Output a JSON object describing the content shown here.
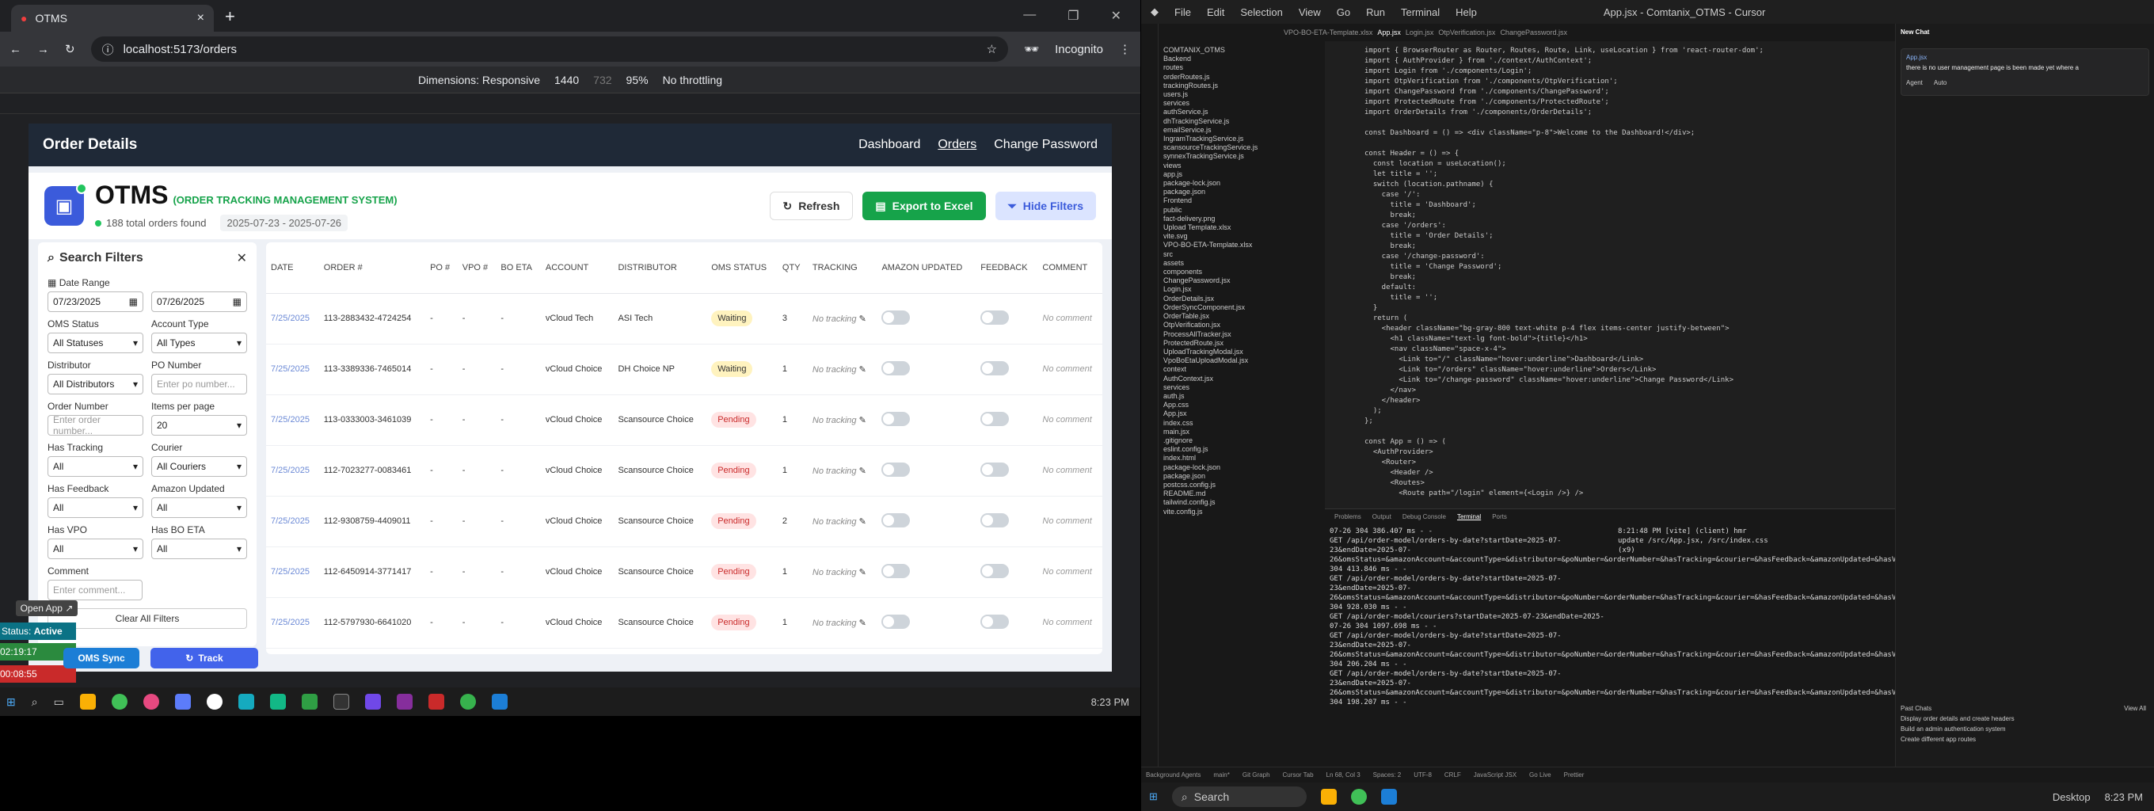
{
  "browser": {
    "tab_title": "OTMS",
    "url": "localhost:5173/orders",
    "profile": "Incognito",
    "dimensions_label": "Dimensions: Responsive",
    "width_value": "1440",
    "height_value": "732",
    "zoom": "95%",
    "throttling": "No throttling"
  },
  "app": {
    "page_title": "Order Details",
    "nav": [
      "Dashboard",
      "Orders",
      "Change Password"
    ],
    "brand": "OTMS",
    "brand_sub": "(ORDER TRACKING MANAGEMENT SYSTEM)",
    "orders_found": "188 total orders found",
    "date_range": "2025-07-23 - 2025-07-26",
    "refresh_label": "Refresh",
    "export_label": "Export to Excel",
    "hide_filters_label": "Hide Filters"
  },
  "filters": {
    "title": "Search Filters",
    "date_range_label": "Date Range",
    "date_from": "07/23/2025",
    "date_to": "07/26/2025",
    "oms_status_label": "OMS Status",
    "oms_status_value": "All Statuses",
    "account_type_label": "Account Type",
    "account_type_value": "All Types",
    "distributor_label": "Distributor",
    "distributor_value": "All Distributors",
    "po_number_label": "PO Number",
    "po_number_placeholder": "Enter po number...",
    "order_number_label": "Order Number",
    "order_number_placeholder": "Enter order number...",
    "items_per_page_label": "Items per page",
    "items_per_page_value": "20",
    "has_tracking_label": "Has Tracking",
    "has_tracking_value": "All",
    "courier_label": "Courier",
    "courier_value": "All Couriers",
    "has_feedback_label": "Has Feedback",
    "has_feedback_value": "All",
    "amazon_updated_label": "Amazon Updated",
    "amazon_updated_value": "All",
    "has_vpo_label": "Has VPO",
    "has_vpo_value": "All",
    "has_bo_eta_label": "Has BO ETA",
    "has_bo_eta_value": "All",
    "comment_label": "Comment",
    "comment_placeholder": "Enter comment...",
    "clear_all_label": "Clear All Filters"
  },
  "table": {
    "headers": [
      "DATE",
      "ORDER #",
      "PO #",
      "VPO #",
      "BO ETA",
      "ACCOUNT",
      "DISTRIBUTOR",
      "OMS STATUS",
      "QTY",
      "TRACKING",
      "AMAZON UPDATED",
      "FEEDBACK",
      "COMMENT"
    ],
    "rows": [
      {
        "date": "7/25/2025",
        "order": "113-2883432-4724254",
        "po": "-",
        "vpo": "-",
        "bo_eta": "-",
        "account": "vCloud Tech",
        "distributor": "ASI Tech",
        "status": "Waiting",
        "qty": "3",
        "tracking": "No tracking",
        "comment": "No comment"
      },
      {
        "date": "7/25/2025",
        "order": "113-3389336-7465014",
        "po": "-",
        "vpo": "-",
        "bo_eta": "-",
        "account": "vCloud Choice",
        "distributor": "DH Choice NP",
        "status": "Waiting",
        "qty": "1",
        "tracking": "No tracking",
        "comment": "No comment"
      },
      {
        "date": "7/25/2025",
        "order": "113-0333003-3461039",
        "po": "-",
        "vpo": "-",
        "bo_eta": "-",
        "account": "vCloud Choice",
        "distributor": "Scansource Choice",
        "status": "Pending",
        "qty": "1",
        "tracking": "No tracking",
        "comment": "No comment"
      },
      {
        "date": "7/25/2025",
        "order": "112-7023277-0083461",
        "po": "-",
        "vpo": "-",
        "bo_eta": "-",
        "account": "vCloud Choice",
        "distributor": "Scansource Choice",
        "status": "Pending",
        "qty": "1",
        "tracking": "No tracking",
        "comment": "No comment"
      },
      {
        "date": "7/25/2025",
        "order": "112-9308759-4409011",
        "po": "-",
        "vpo": "-",
        "bo_eta": "-",
        "account": "vCloud Choice",
        "distributor": "Scansource Choice",
        "status": "Pending",
        "qty": "2",
        "tracking": "No tracking",
        "comment": "No comment"
      },
      {
        "date": "7/25/2025",
        "order": "112-6450914-3771417",
        "po": "-",
        "vpo": "-",
        "bo_eta": "-",
        "account": "vCloud Choice",
        "distributor": "Scansource Choice",
        "status": "Pending",
        "qty": "1",
        "tracking": "No tracking",
        "comment": "No comment"
      },
      {
        "date": "7/25/2025",
        "order": "112-5797930-6641020",
        "po": "-",
        "vpo": "-",
        "bo_eta": "-",
        "account": "vCloud Choice",
        "distributor": "Scansource Choice",
        "status": "Pending",
        "qty": "1",
        "tracking": "No tracking",
        "comment": "No comment"
      }
    ]
  },
  "overlay": {
    "open_app": "Open App",
    "status_label": "Status:",
    "status_value": "Active",
    "timer1": "02:19:17",
    "timer2": "00:08:55",
    "oms_sync": "OMS Sync",
    "track": "Track"
  },
  "taskbar_left": {
    "clock": "8:23 PM"
  },
  "vscode": {
    "title": "App.jsx - Comtanix_OTMS - Cursor",
    "menu": [
      "File",
      "Edit",
      "Selection",
      "View",
      "Go",
      "Run",
      "Terminal",
      "Help"
    ],
    "tabs": [
      "VPO-BO-ETA-Template.xlsx",
      "App.jsx",
      "Login.jsx",
      "OtpVerification.jsx",
      "ChangePassword.jsx"
    ],
    "breadcrumb": "Frontend > src > App.jsx > ...",
    "explorer": [
      "COMTANIX_OTMS",
      "Backend",
      "routes",
      "orderRoutes.js",
      "trackingRoutes.js",
      "users.js",
      "services",
      "authService.js",
      "dhTrackingService.js",
      "emailService.js",
      "IngramTrackingService.js",
      "scansourceTrackingService.js",
      "synnexTrackingService.js",
      "views",
      "app.js",
      "package-lock.json",
      "package.json",
      "Frontend",
      "public",
      "fact-delivery.png",
      "Upload Template.xlsx",
      "vite.svg",
      "VPO-BO-ETA-Template.xlsx",
      "src",
      "assets",
      "components",
      "ChangePassword.jsx",
      "Login.jsx",
      "OrderDetails.jsx",
      "OrderSyncComponent.jsx",
      "OrderTable.jsx",
      "OtpVerification.jsx",
      "ProcessAllTracker.jsx",
      "ProtectedRoute.jsx",
      "UploadTrackingModal.jsx",
      "VpoBoEtaUploadModal.jsx",
      "context",
      "AuthContext.jsx",
      "services",
      "auth.js",
      "App.css",
      "App.jsx",
      "index.css",
      "main.jsx",
      ".gitignore",
      "eslint.config.js",
      "index.html",
      "package-lock.json",
      "package.json",
      "postcss.config.js",
      "README.md",
      "tailwind.config.js",
      "vite.config.js"
    ],
    "code": [
      "import { BrowserRouter as Router, Routes, Route, Link, useLocation } from 'react-router-dom';",
      "import { AuthProvider } from './context/AuthContext';",
      "import Login from './components/Login';",
      "import OtpVerification from './components/OtpVerification';",
      "import ChangePassword from './components/ChangePassword';",
      "import ProtectedRoute from './components/ProtectedRoute';",
      "import OrderDetails from './components/OrderDetails';",
      "",
      "const Dashboard = () => <div className=\"p-8\">Welcome to the Dashboard!</div>;",
      "",
      "const Header = () => {",
      "  const location = useLocation();",
      "  let title = '';",
      "  switch (location.pathname) {",
      "    case '/':",
      "      title = 'Dashboard';",
      "      break;",
      "    case '/orders':",
      "      title = 'Order Details';",
      "      break;",
      "    case '/change-password':",
      "      title = 'Change Password';",
      "      break;",
      "    default:",
      "      title = '';",
      "  }",
      "  return (",
      "    <header className=\"bg-gray-800 text-white p-4 flex items-center justify-between\">",
      "      <h1 className=\"text-lg font-bold\">{title}</h1>",
      "      <nav className=\"space-x-4\">",
      "        <Link to=\"/\" className=\"hover:underline\">Dashboard</Link>",
      "        <Link to=\"/orders\" className=\"hover:underline\">Orders</Link>",
      "        <Link to=\"/change-password\" className=\"hover:underline\">Change Password</Link>",
      "      </nav>",
      "    </header>",
      "  );",
      "};",
      "",
      "const App = () => (",
      "  <AuthProvider>",
      "    <Router>",
      "      <Header />",
      "      <Routes>",
      "        <Route path=\"/login\" element={<Login />} />"
    ],
    "panel_tabs": [
      "Problems",
      "Output",
      "Debug Console",
      "Terminal",
      "Ports"
    ],
    "terminal_left": "07-26 304 386.407 ms - -\nGET /api/order-model/orders-by-date?startDate=2025-07-23&endDate=2025-07-26&omsStatus=&amazonAccount=&accountType=&distributor=&poNumber=&orderNumber=&hasTracking=&courier=&hasFeedback=&amazonUpdated=&hasVpo=&hasBoEta=&comment=&page=1&limit=20 304 413.846 ms - -\nGET /api/order-model/orders-by-date?startDate=2025-07-23&endDate=2025-07-26&omsStatus=&amazonAccount=&accountType=&distributor=&poNumber=&orderNumber=&hasTracking=&courier=&hasFeedback=&amazonUpdated=&hasVpo=&hasBoEta=&comment=&page=1&limit=20 304 928.030 ms - -\nGET /api/order-model/couriers?startDate=2025-07-23&endDate=2025-07-26 304 1097.698 ms - -\nGET /api/order-model/orders-by-date?startDate=2025-07-23&endDate=2025-07-26&omsStatus=&amazonAccount=&accountType=&distributor=&poNumber=&orderNumber=&hasTracking=&courier=&hasFeedback=&amazonUpdated=&hasVpo=&hasBoEta=&comment=&page=1&limit=20 304 206.204 ms - -\nGET /api/order-model/orders-by-date?startDate=2025-07-23&endDate=2025-07-26&omsStatus=&amazonAccount=&accountType=&distributor=&poNumber=&orderNumber=&hasTracking=&courier=&hasFeedback=&amazonUpdated=&hasVpo=&hasBoEta=&comment=&page=1&limit=20 304 198.207 ms - -",
    "terminal_right": "8:21:48 PM [vite] (client) hmr update /src/App.jsx, /src/index.css (x9)",
    "chat_title": "New Chat",
    "chat_file": "App.jsx",
    "chat_input": "there is no user management page is been made yet where a",
    "chat_mode": "Agent",
    "chat_auto": "Auto",
    "past_chats": "Past Chats",
    "view_all": "View All",
    "past_items": [
      "Display order details and create headers",
      "Build an admin authentication system",
      "Create different app routes"
    ],
    "status_items": [
      "Background Agents",
      "main*",
      "Git Graph",
      "Cursor Tab",
      "Ln 68, Col 3",
      "Spaces: 2",
      "UTF-8",
      "CRLF",
      "JavaScript JSX",
      "Go Live",
      "Prettier"
    ],
    "search_label": "Search",
    "desktop_label": "Desktop",
    "clock": "8:23 PM"
  }
}
